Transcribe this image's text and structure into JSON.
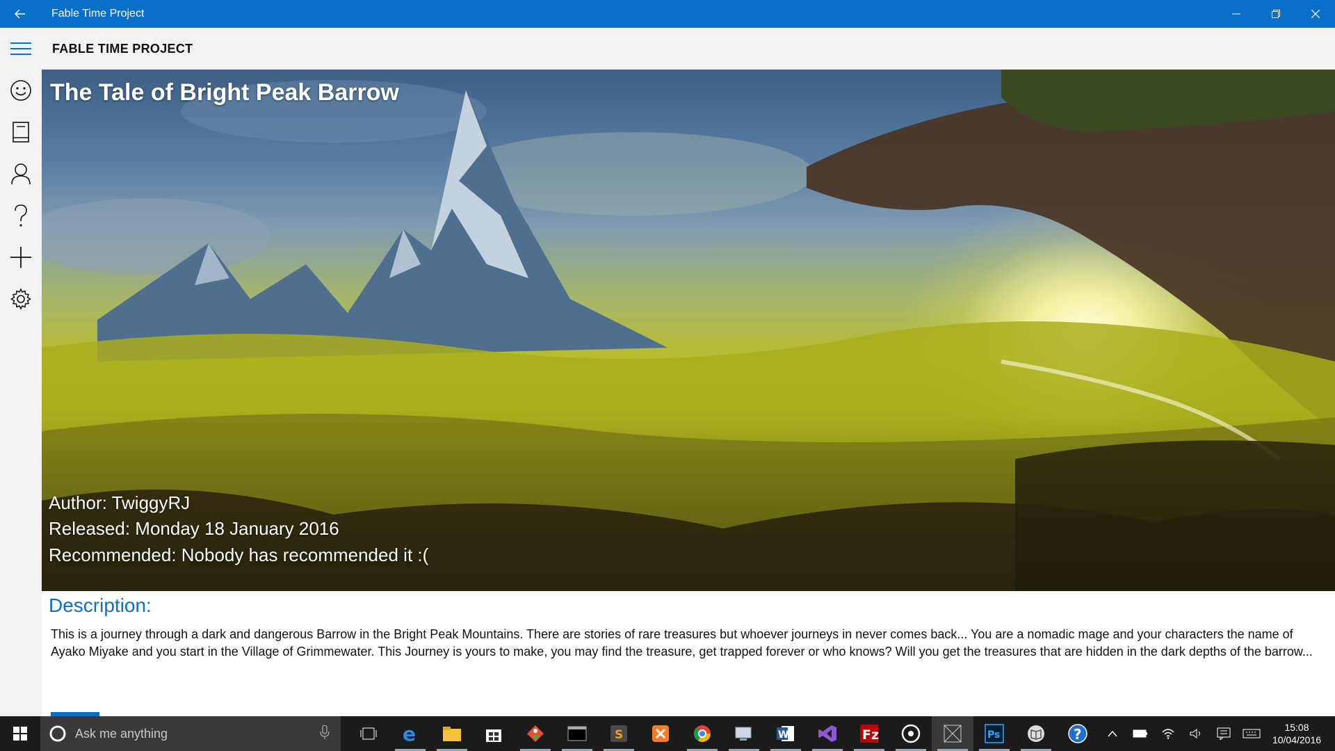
{
  "window": {
    "title": "Fable Time Project"
  },
  "header": {
    "app_title": "FABLE TIME PROJECT"
  },
  "rail": {
    "items": [
      {
        "icon": "smiley-icon"
      },
      {
        "icon": "book-icon"
      },
      {
        "icon": "person-icon"
      },
      {
        "icon": "question-icon"
      },
      {
        "icon": "plus-icon"
      },
      {
        "icon": "gear-icon"
      }
    ]
  },
  "story": {
    "title": "The Tale of Bright Peak Barrow",
    "author": "Author: TwiggyRJ",
    "released": "Released:  Monday 18 January 2016",
    "recommended": "Recommended:  Nobody has recommended it :("
  },
  "description": {
    "heading": "Description:",
    "text": "This is a journey through a dark and dangerous Barrow in the Bright Peak Mountains. There are stories of rare treasures but whoever journeys in never comes back... You are a nomadic mage and your characters the name of Ayako Miyake and you start in the Village of Grimmewater. This Journey is yours to make, you may find the treasure, get trapped forever or who knows? Will you get the treasures that are hidden in the dark depths of the barrow..."
  },
  "taskbar": {
    "search_placeholder": "Ask me anything",
    "pinned": [
      "task-view-icon",
      "edge-icon",
      "file-explorer-icon",
      "store-icon",
      "git-icon",
      "terminal-icon",
      "sublime-icon",
      "xampp-icon",
      "chrome-icon",
      "remote-desktop-icon",
      "word-icon",
      "visual-studio-icon",
      "filezilla-icon",
      "media-icon",
      "app-icon",
      "photoshop-icon",
      "reader-icon",
      "help-icon"
    ]
  },
  "clock": {
    "time": "15:08",
    "date": "10/04/2016"
  },
  "colors": {
    "accent": "#0a6fc9",
    "taskbar": "#1b1b1b"
  }
}
